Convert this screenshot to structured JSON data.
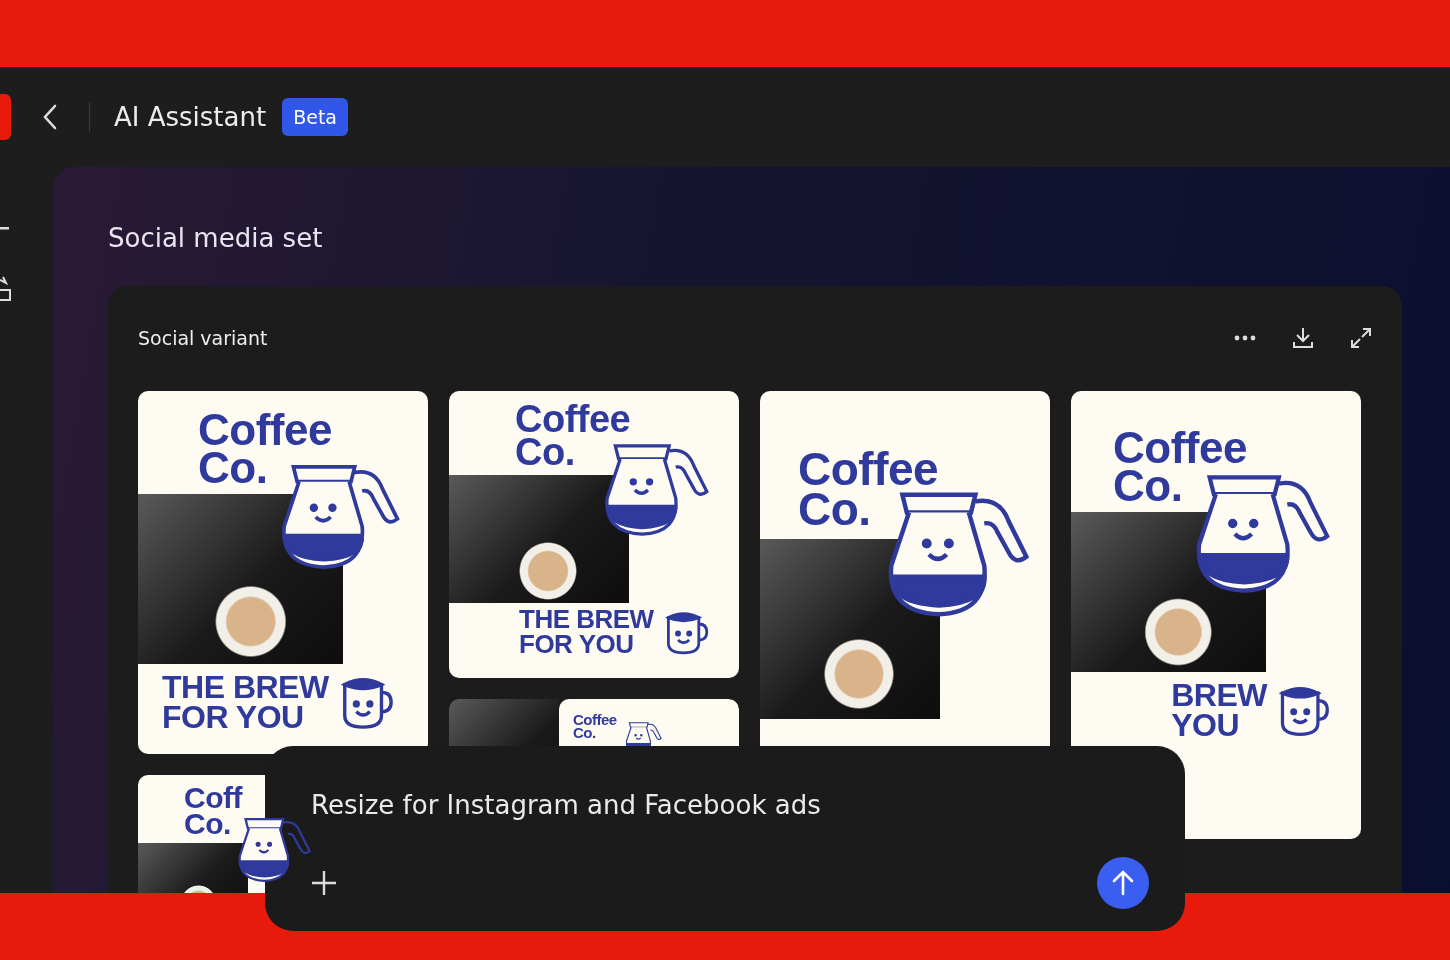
{
  "header": {
    "title": "AI Assistant",
    "badge": "Beta"
  },
  "section_title": "Social media set",
  "card": {
    "title": "Social variant"
  },
  "variant_columns": [
    {
      "variants": [
        {
          "kind": "portrait",
          "headline": [
            "Coffee",
            "Co."
          ],
          "tagline": [
            "THE BREW",
            "FOR YOU"
          ]
        },
        {
          "kind": "cutoff",
          "headline": [
            "Coff",
            "Co."
          ]
        }
      ]
    },
    {
      "variants": [
        {
          "kind": "square",
          "headline": [
            "Coffee",
            "Co."
          ],
          "tagline": [
            "THE BREW",
            "FOR YOU"
          ]
        },
        {
          "kind": "banner",
          "headline": [
            "Coffee",
            "Co."
          ]
        }
      ]
    },
    {
      "variants": [
        {
          "kind": "story",
          "headline": [
            "Coffee",
            "Co."
          ]
        }
      ]
    },
    {
      "variants": [
        {
          "kind": "tall",
          "headline": [
            "Coffee",
            "Co."
          ],
          "tagline": [
            "BREW",
            "YOU"
          ]
        }
      ]
    }
  ],
  "prompt": {
    "value": "Resize for Instagram and Facebook ads"
  }
}
